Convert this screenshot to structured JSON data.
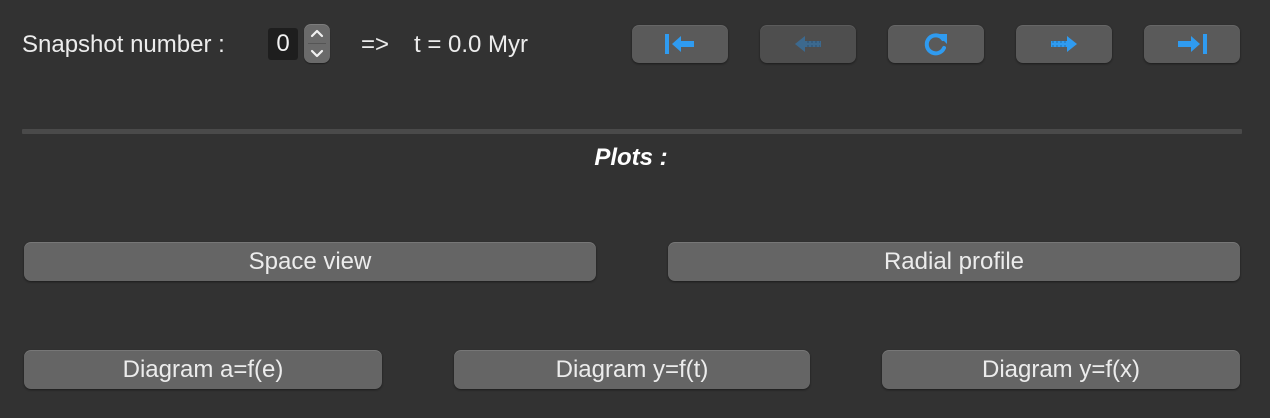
{
  "snapshot": {
    "label": "Snapshot number :",
    "value": "0",
    "arrow": "=>",
    "time_text": "t = 0.0 Myr",
    "stepper_up_icon": "chevron-up-icon",
    "stepper_down_icon": "chevron-down-icon"
  },
  "navigation": {
    "buttons": [
      {
        "icon": "first-snapshot-icon",
        "enabled": true
      },
      {
        "icon": "previous-snapshot-icon",
        "enabled": false
      },
      {
        "icon": "refresh-icon",
        "enabled": true
      },
      {
        "icon": "next-snapshot-icon",
        "enabled": true
      },
      {
        "icon": "last-snapshot-icon",
        "enabled": true
      }
    ]
  },
  "plots": {
    "title": "Plots :",
    "buttons": {
      "space_view": "Space view",
      "radial_profile": "Radial profile",
      "diagram_ae": "Diagram a=f(e)",
      "diagram_yt": "Diagram y=f(t)",
      "diagram_yx": "Diagram y=f(x)"
    }
  },
  "colors": {
    "background": "#323232",
    "button": "#656565",
    "icon_blue": "#2f9bf0"
  }
}
